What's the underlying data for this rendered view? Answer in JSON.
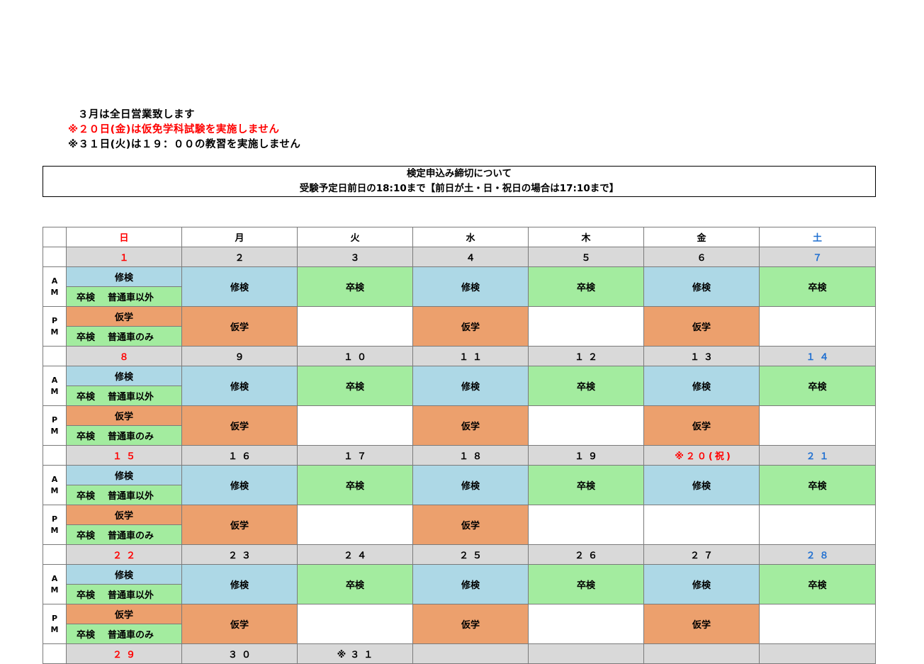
{
  "notices": [
    {
      "text": "３月は全日営業致します",
      "color": "black"
    },
    {
      "text": "※２０日(金)は仮免学科試験を実施しません",
      "color": "red"
    },
    {
      "text": "※３１日(火)は１９：００の教習を実施しません",
      "color": "black"
    }
  ],
  "deadline": {
    "title": "検定申込み締切について",
    "detail": "受験予定日前日の18:10まで【前日が土・日・祝日の場合は17:10まで】"
  },
  "weekdays": [
    "日",
    "月",
    "火",
    "水",
    "木",
    "金",
    "土"
  ],
  "labels": {
    "am": [
      "A",
      "M"
    ],
    "pm": [
      "P",
      "M"
    ]
  },
  "side": {
    "am_top": "修検",
    "am_bottom_a": "卒検",
    "am_bottom_b": "普通車以外",
    "pm_top": "仮学",
    "pm_bottom_a": "卒検",
    "pm_bottom_b": "普通車のみ"
  },
  "colors": {
    "shuuken": "#add8e6",
    "sotsuken": "#a3ec9f",
    "karigaku": "#eca06d",
    "date_row": "#d9d9d9",
    "sunday": "#ff0000",
    "saturday": "#1f6fd1"
  },
  "weeks": [
    {
      "dates": [
        "１",
        "２",
        "３",
        "４",
        "５",
        "６",
        "７"
      ],
      "am": [
        "修検",
        "卒検",
        "修検",
        "卒検",
        "修検",
        "卒検"
      ],
      "pm": [
        "仮学",
        "",
        "仮学",
        "",
        "仮学",
        ""
      ]
    },
    {
      "dates": [
        "８",
        "９",
        "１０",
        "１１",
        "１２",
        "１３",
        "１４"
      ],
      "am": [
        "修検",
        "卒検",
        "修検",
        "卒検",
        "修検",
        "卒検"
      ],
      "pm": [
        "仮学",
        "",
        "仮学",
        "",
        "仮学",
        ""
      ]
    },
    {
      "dates": [
        "１５",
        "１６",
        "１７",
        "１８",
        "１９",
        "※２０(祝)",
        "２１"
      ],
      "am": [
        "修検",
        "卒検",
        "修検",
        "卒検",
        "修検",
        "卒検"
      ],
      "pm": [
        "仮学",
        "",
        "仮学",
        "",
        "",
        ""
      ]
    },
    {
      "dates": [
        "２２",
        "２３",
        "２４",
        "２５",
        "２６",
        "２７",
        "２８"
      ],
      "am": [
        "修検",
        "卒検",
        "修検",
        "卒検",
        "修検",
        "卒検"
      ],
      "pm": [
        "仮学",
        "",
        "仮学",
        "",
        "仮学",
        ""
      ]
    },
    {
      "dates": [
        "２９",
        "３０",
        "※３１",
        "",
        "",
        "",
        ""
      ]
    }
  ]
}
